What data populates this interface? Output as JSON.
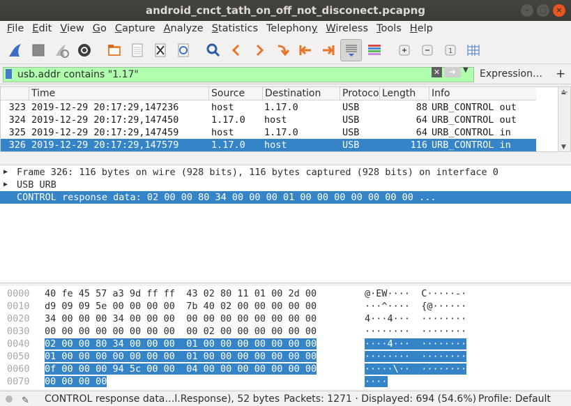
{
  "window": {
    "title": "android_cnct_tath_on_off_not_disconect.pcapng"
  },
  "menu": [
    {
      "u": "F",
      "rest": "ile"
    },
    {
      "u": "E",
      "rest": "dit"
    },
    {
      "u": "V",
      "rest": "iew"
    },
    {
      "u": "G",
      "rest": "o"
    },
    {
      "u": "C",
      "rest": "apture"
    },
    {
      "u": "A",
      "rest": "nalyze"
    },
    {
      "u": "S",
      "rest": "tatistics"
    },
    {
      "u": "",
      "rest": "Telephony",
      "pre": "Telephon",
      "uu": "y"
    },
    {
      "u": "W",
      "rest": "ireless"
    },
    {
      "u": "T",
      "rest": "ools",
      "pre": ""
    },
    {
      "u": "H",
      "rest": "elp"
    }
  ],
  "toolbar_icons": [
    "shark-fin-icon",
    "stop-icon",
    "restart-icon",
    "options-gear-icon",
    "open-folder-icon",
    "file-set-icon",
    "close-file-icon",
    "reload-icon",
    "find-icon",
    "back-arrow-icon",
    "forward-arrow-icon",
    "go-to-packet-icon",
    "first-packet-icon",
    "last-packet-icon",
    "autoscroll-icon",
    "colorize-icon",
    "zoom-in-icon",
    "zoom-out-icon",
    "normal-size-icon",
    "resize-columns-icon"
  ],
  "filter": {
    "value": "usb.addr contains \"1.17\"",
    "expression_label": "Expression…",
    "plus_label": "+"
  },
  "packet_list": {
    "headers": [
      "Time",
      "Source",
      "Destination",
      "Protoco",
      "Length",
      "Info"
    ],
    "rows": [
      {
        "no": "323",
        "time": "2019-12-29 20:17:29,147236",
        "src": "host",
        "dst": "1.17.0",
        "proto": "USB",
        "len": "88",
        "info": "URB_CONTROL out"
      },
      {
        "no": "324",
        "time": "2019-12-29 20:17:29,147450",
        "src": "1.17.0",
        "dst": "host",
        "proto": "USB",
        "len": "64",
        "info": "URB_CONTROL out"
      },
      {
        "no": "325",
        "time": "2019-12-29 20:17:29,147459",
        "src": "host",
        "dst": "1.17.0",
        "proto": "USB",
        "len": "64",
        "info": "URB_CONTROL in"
      },
      {
        "no": "326",
        "time": "2019-12-29 20:17:29,147579",
        "src": "1.17.0",
        "dst": "host",
        "proto": "USB",
        "len": "116",
        "info": "URB_CONTROL in"
      }
    ],
    "selected_index": 3
  },
  "details": [
    {
      "arrow": "▶",
      "text": "Frame 326: 116 bytes on wire (928 bits), 116 bytes captured (928 bits) on interface 0"
    },
    {
      "arrow": "▶",
      "text": "USB URB"
    },
    {
      "arrow": "",
      "text": "CONTROL response data: 02 00 00 80 34 00 00 00 01 00 00 00 00 00 00 00 ..."
    }
  ],
  "bytes": [
    {
      "off": "0000",
      "hex": "40 fe 45 57 a3 9d ff ff  43 02 80 11 01 00 2d 00",
      "hl_hex": "",
      "ascii": "@·EW····  C·····-·",
      "hl_ascii": ""
    },
    {
      "off": "0010",
      "hex": "d9 09 09 5e 00 00 00 00  7b 40 02 00 00 00 00 00",
      "hl_hex": "",
      "ascii": "···^····  {@······",
      "hl_ascii": ""
    },
    {
      "off": "0020",
      "hex": "34 00 00 00 34 00 00 00  00 00 00 00 00 00 00 00",
      "hl_hex": "",
      "ascii": "4···4···  ········",
      "hl_ascii": ""
    },
    {
      "off": "0030",
      "hex": "00 00 00 00 00 00 00 00  00 02 00 00 00 00 00 00",
      "hl_hex": "",
      "ascii": "········  ········",
      "hl_ascii": ""
    },
    {
      "off": "0040",
      "hex": "",
      "hl_hex": "02 00 00 80 34 00 00 00  01 00 00 00 00 00 00 00",
      "ascii": "",
      "hl_ascii": "····4···  ········"
    },
    {
      "off": "0050",
      "hex": "",
      "hl_hex": "01 00 00 00 00 00 00 00  01 00 00 00 00 00 00 00",
      "ascii": "",
      "hl_ascii": "········  ········"
    },
    {
      "off": "0060",
      "hex": "",
      "hl_hex": "0f 00 00 00 94 5c 00 00  04 00 00 00 00 00 00 00",
      "ascii": "",
      "hl_ascii": "·····\\··  ········"
    },
    {
      "off": "0070",
      "hex": "",
      "hl_hex": "00 00 00 00",
      "ascii": "",
      "hl_ascii": "····"
    }
  ],
  "status": {
    "left": "CONTROL response data…l.Response), 52 bytes",
    "middle": "Packets: 1271 · Displayed: 694 (54.6%)",
    "right": "Profile: Default"
  },
  "colors": {
    "selection": "#3584c7",
    "filter_ok": "#afffaf",
    "titlebar": "#3b3a36",
    "close_button": "#e9541f"
  }
}
